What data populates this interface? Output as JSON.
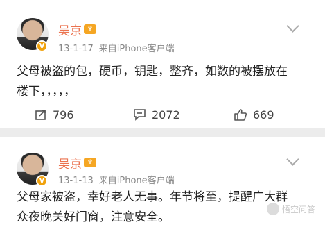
{
  "posts": [
    {
      "author": "吴京",
      "vip_badge": "V",
      "date": "13-1-17",
      "source": "来自iPhone客户端",
      "text_line1": "父母被盗的包，硬币，钥匙，整齐，如数的被摆放在",
      "text_line2": "楼下，，，，，",
      "repost_count": "796",
      "comment_count": "2072",
      "like_count": "669"
    },
    {
      "author": "吴京",
      "vip_badge": "V",
      "date": "13-1-13",
      "source": "来自iPhone客户端",
      "text_line1": "父母家被盗，幸好老人无事。年节将至，提醒广大群",
      "text_line2": "众夜晚关好门窗，注意安全。"
    }
  ],
  "watermark": "悟空问答",
  "colors": {
    "name": "#eb7350",
    "badge": "#f0a20d"
  },
  "icons": [
    "avatar",
    "verified-badge",
    "vip-icon",
    "chevron-down-icon",
    "repost-icon",
    "comment-icon",
    "like-icon"
  ]
}
